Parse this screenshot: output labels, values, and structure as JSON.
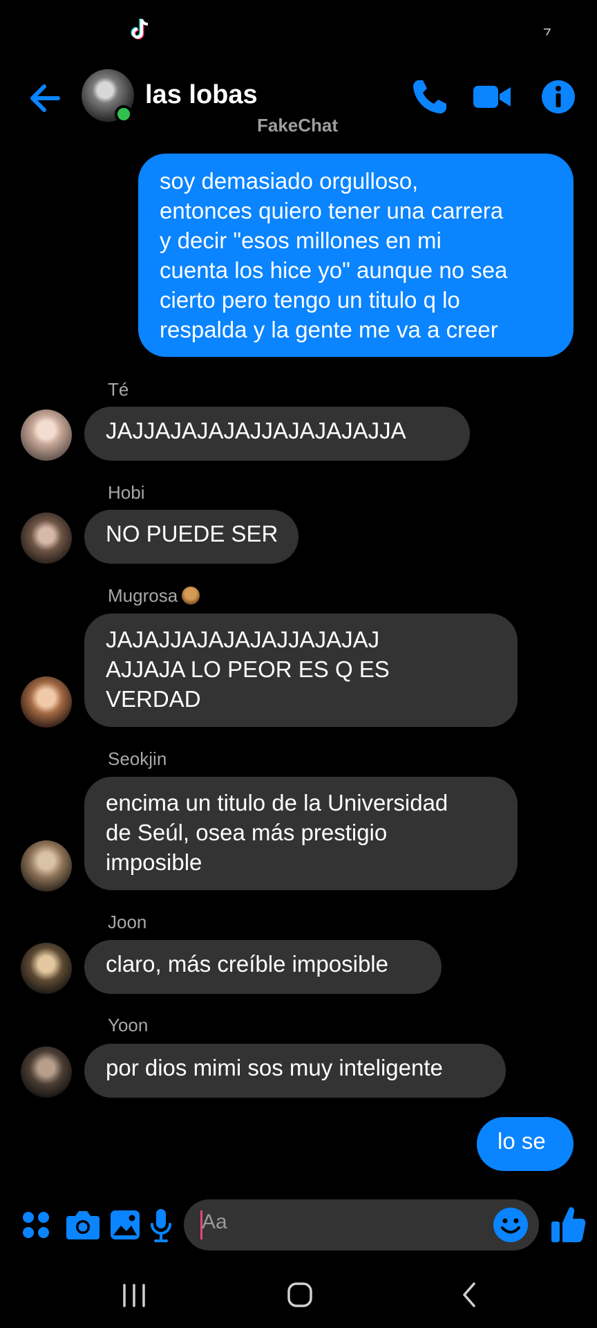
{
  "header": {
    "title": "las lobas",
    "watermark": "FakeChat"
  },
  "messages": [
    {
      "type": "outgoing",
      "lines": [
        "soy demasiado orgulloso,",
        "entonces quiero tener una carrera",
        "y decir \"esos millones en mi",
        "cuenta los hice yo\" aunque no sea",
        "cierto pero tengo un titulo q lo",
        "respalda y la gente me va a creer"
      ]
    },
    {
      "type": "incoming",
      "sender": "Té",
      "lines": [
        "JAJJAJAJAJAJJAJAJAJAJJA"
      ]
    },
    {
      "type": "incoming",
      "sender": "Hobi",
      "lines": [
        "NO PUEDE SER"
      ]
    },
    {
      "type": "incoming",
      "sender": "Mugrosa",
      "sender_emoji": "monkey-emoji",
      "lines": [
        "JAJAJJAJAJAJAJJAJAJAJ",
        "AJJAJA LO PEOR ES Q ES",
        "VERDAD"
      ]
    },
    {
      "type": "incoming",
      "sender": "Seokjin",
      "lines": [
        "encima un titulo de la Universidad",
        "de Seúl, osea más prestigio",
        "imposible"
      ]
    },
    {
      "type": "incoming",
      "sender": "Joon",
      "lines": [
        "claro, más creíble imposible"
      ]
    },
    {
      "type": "incoming",
      "sender": "Yoon",
      "lines": [
        "por dios mimi sos muy inteligente"
      ]
    },
    {
      "type": "outgoing",
      "lines": [
        "lo se"
      ]
    }
  ],
  "composer": {
    "placeholder": "Aa"
  },
  "icons": {
    "status": [
      "tiktok-icon",
      "signal-icon"
    ],
    "header": [
      "back-arrow-icon",
      "phone-icon",
      "video-camera-icon",
      "info-icon"
    ],
    "composer": [
      "apps-icon",
      "camera-icon",
      "gallery-icon",
      "microphone-icon",
      "emoji-icon",
      "thumbs-up-icon"
    ],
    "navigation": [
      "recent-apps-icon",
      "home-icon",
      "back-icon"
    ]
  },
  "colors": {
    "accent": "#0a84ff",
    "background": "#000000",
    "incoming_bubble": "#333333",
    "online": "#31c24d",
    "caret": "#e8457a"
  }
}
